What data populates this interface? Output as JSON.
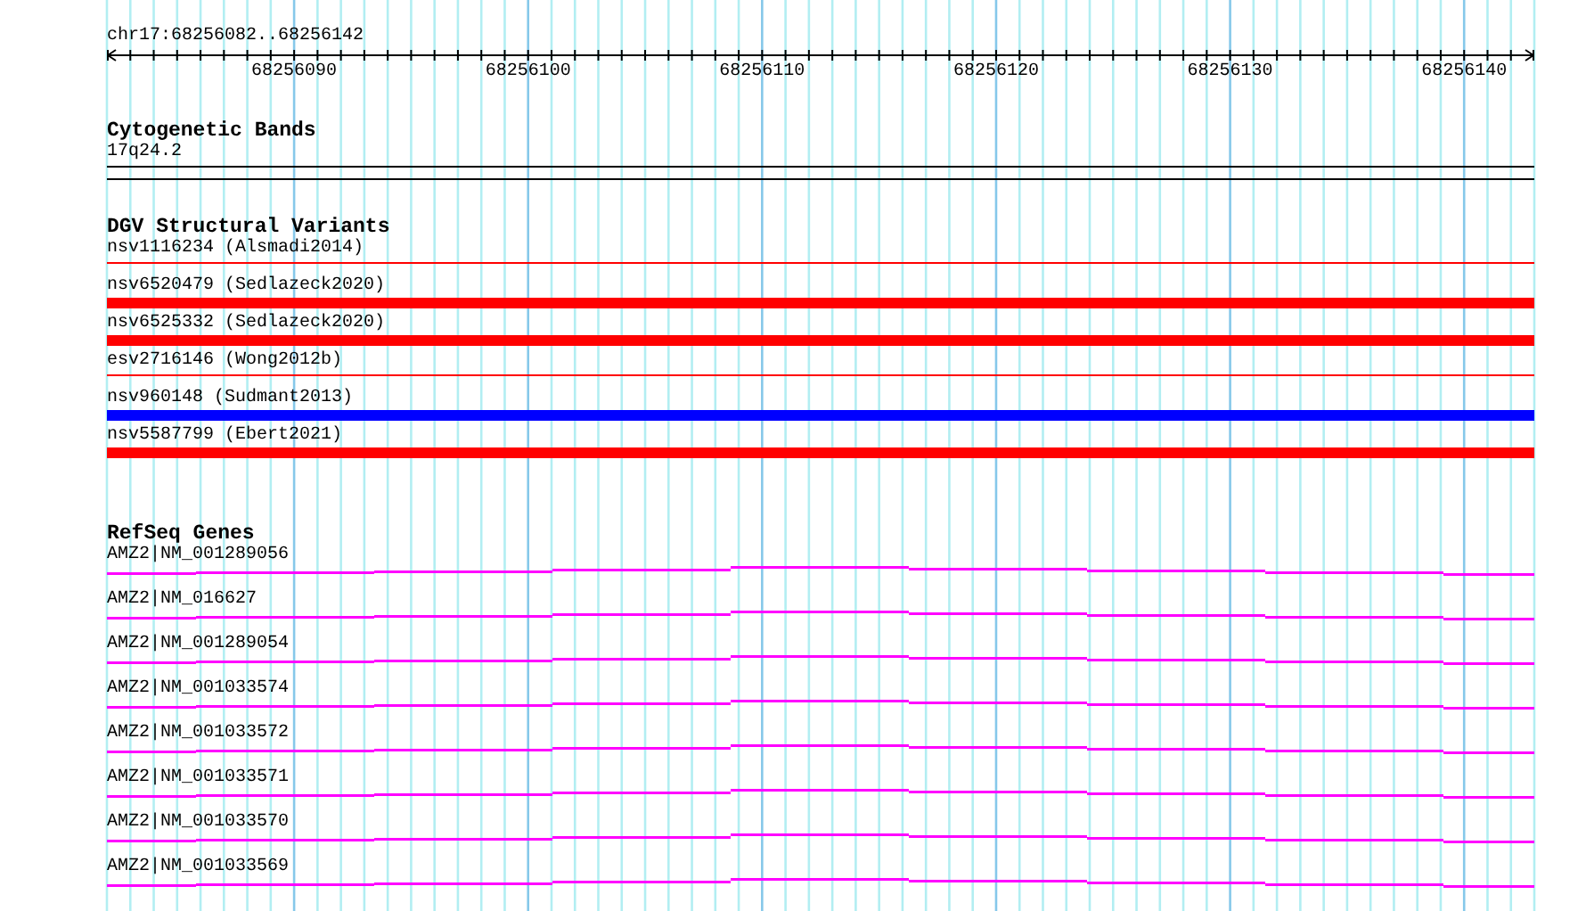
{
  "location": "chr17:68256082..68256142",
  "ruler": {
    "ticks": [
      "68256090",
      "68256100",
      "68256110",
      "68256120",
      "68256130",
      "68256140"
    ]
  },
  "tracks": [
    {
      "kind": "cytoband",
      "title": "Cytogenetic Bands",
      "features": [
        {
          "label": "17q24.2"
        }
      ]
    },
    {
      "kind": "variants",
      "title": "DGV Structural Variants",
      "features": [
        {
          "label": "nsv1116234 (Alsmadi2014)",
          "color": "#ff0000",
          "kind": "thin"
        },
        {
          "label": "nsv6520479 (Sedlazeck2020)",
          "color": "#ff0000",
          "kind": "thick"
        },
        {
          "label": "nsv6525332 (Sedlazeck2020)",
          "color": "#ff0000",
          "kind": "thick"
        },
        {
          "label": "esv2716146 (Wong2012b)",
          "color": "#ff0000",
          "kind": "thin"
        },
        {
          "label": "nsv960148 (Sudmant2013)",
          "color": "#0000ff",
          "kind": "thick"
        },
        {
          "label": "nsv5587799 (Ebert2021)",
          "color": "#ff0000",
          "kind": "thick"
        }
      ]
    },
    {
      "kind": "genes",
      "title": "RefSeq Genes",
      "features": [
        {
          "label": "AMZ2|NM_001289056"
        },
        {
          "label": "AMZ2|NM_016627"
        },
        {
          "label": "AMZ2|NM_001289054"
        },
        {
          "label": "AMZ2|NM_001033574"
        },
        {
          "label": "AMZ2|NM_001033572"
        },
        {
          "label": "AMZ2|NM_001033571"
        },
        {
          "label": "AMZ2|NM_001033570"
        },
        {
          "label": "AMZ2|NM_001033569"
        }
      ]
    }
  ]
}
